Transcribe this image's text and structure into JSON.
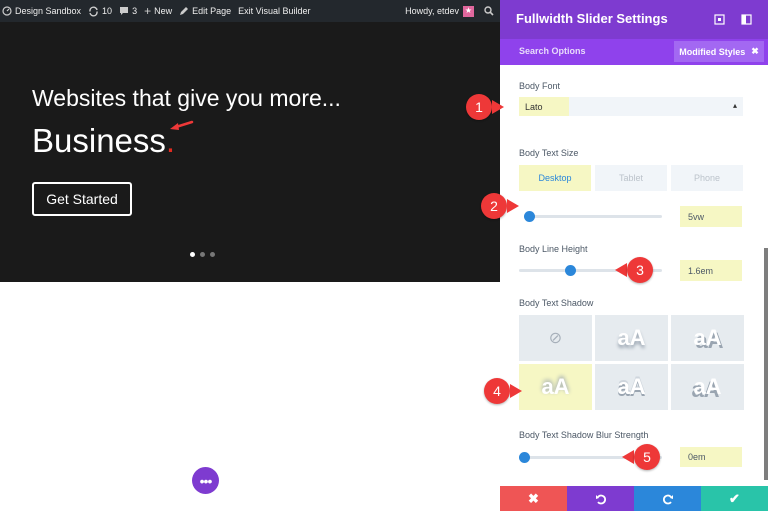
{
  "admin_bar": {
    "site_name": "Design Sandbox",
    "updates_count": "10",
    "comments_count": "3",
    "new_label": "New",
    "edit_page_label": "Edit Page",
    "exit_builder_label": "Exit Visual Builder",
    "greeting": "Howdy, etdev"
  },
  "hero": {
    "tagline": "Websites that give you more...",
    "title": "Business",
    "title_dot": ".",
    "button_label": "Get Started",
    "slide_count": 3,
    "active_slide": 1
  },
  "panel": {
    "title": "Fullwidth Slider Settings",
    "search_options_label": "Search Options",
    "modified_styles_label": "Modified Styles",
    "body_font": {
      "label": "Body Font",
      "value": "Lato"
    },
    "body_text_size": {
      "label": "Body Text Size",
      "tabs": [
        "Desktop",
        "Tablet",
        "Phone"
      ],
      "active_tab": "Desktop",
      "value": "5vw",
      "slider_fraction": 0.0
    },
    "body_line_height": {
      "label": "Body Line Height",
      "value": "1.6em",
      "slider_fraction": 0.35
    },
    "body_text_shadow": {
      "label": "Body Text Shadow",
      "selected_index": 3,
      "sample_text": "aA"
    },
    "blur_strength": {
      "label": "Body Text Shadow Blur Strength",
      "value": "0em",
      "slider_fraction": 0.0
    }
  },
  "footer": {
    "buttons": [
      {
        "icon": "close-icon",
        "color": "#ef5555"
      },
      {
        "icon": "undo-icon",
        "color": "#7e3bd0"
      },
      {
        "icon": "redo-icon",
        "color": "#2b87da"
      },
      {
        "icon": "check-icon",
        "color": "#29c4a9"
      }
    ]
  },
  "callouts": [
    "1",
    "2",
    "3",
    "4",
    "5"
  ],
  "colors": {
    "accent_purple": "#7e3bd0",
    "highlight": "#f6f7c4",
    "callout_red": "#ee3838",
    "slider_blue": "#2b87da"
  }
}
